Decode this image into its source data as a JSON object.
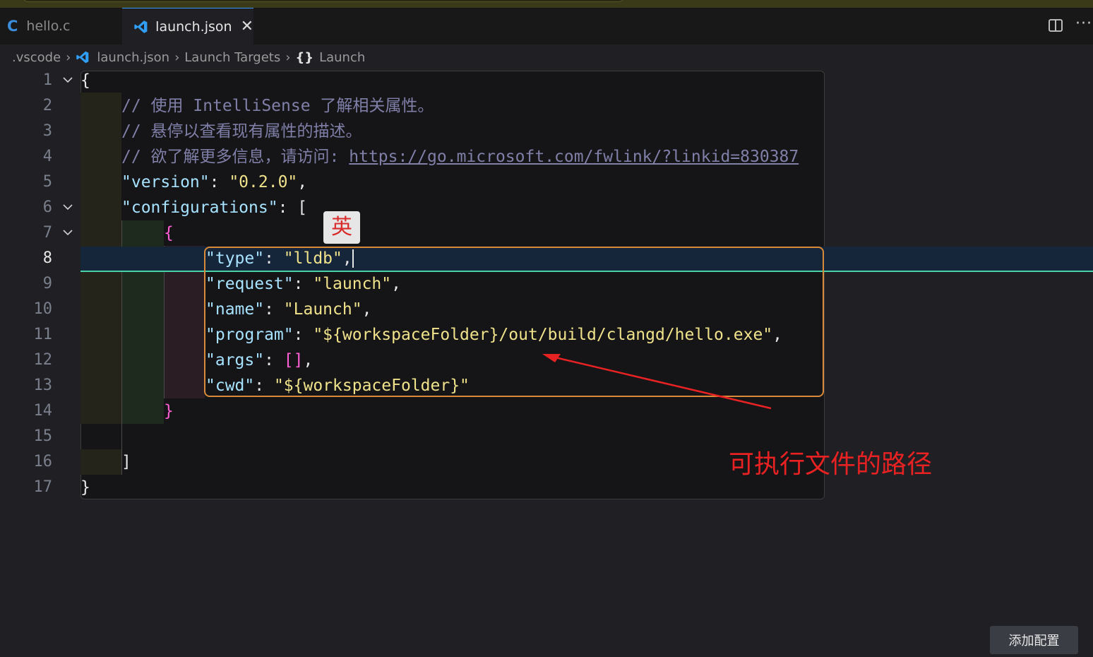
{
  "tabs": [
    {
      "icon": "c-file-icon",
      "glyph": "C",
      "label": "hello.c"
    },
    {
      "icon": "vscode-icon",
      "label": "launch.json",
      "close_glyph": "✕"
    }
  ],
  "toolbar": {
    "more_glyph": "···"
  },
  "breadcrumb": {
    "items": [
      ".vscode",
      "launch.json",
      "Launch Targets",
      "Launch"
    ],
    "separator": "›",
    "braces": "{}"
  },
  "editor": {
    "line_numbers": [
      "1",
      "2",
      "3",
      "4",
      "5",
      "6",
      "7",
      "8",
      "9",
      "10",
      "11",
      "12",
      "13",
      "14",
      "15",
      "16",
      "17"
    ],
    "active_line": "8",
    "lines": {
      "l1": "{",
      "l2": "// 使用 IntelliSense 了解相关属性。",
      "l3": "// 悬停以查看现有属性的描述。",
      "l4_prefix": "// 欲了解更多信息，请访问: ",
      "l4_link": "https://go.microsoft.com/fwlink/?linkid=830387",
      "l5_key": "\"version\"",
      "l5_val": "\"0.2.0\"",
      "l6_key": "\"configurations\"",
      "l6_open": "[",
      "l7": "{",
      "l8_key": "\"type\"",
      "l8_val": "\"lldb\"",
      "l9_key": "\"request\"",
      "l9_val": "\"launch\"",
      "l10_key": "\"name\"",
      "l10_val": "\"Launch\"",
      "l11_key": "\"program\"",
      "l11_val": "\"${workspaceFolder}/out/build/clangd/hello.exe\"",
      "l12_key": "\"args\"",
      "l12_val": "[]",
      "l13_key": "\"cwd\"",
      "l13_val": "\"${workspaceFolder}\"",
      "l14": "}",
      "l16": "]",
      "l17": "}"
    }
  },
  "ime_indicator": "英",
  "annotation": "可执行文件的路径",
  "add_config_button": "添加配置",
  "colors": {
    "accent": "#3794ff",
    "annotation": "#e82222",
    "highlight_box": "#d98a3a"
  }
}
